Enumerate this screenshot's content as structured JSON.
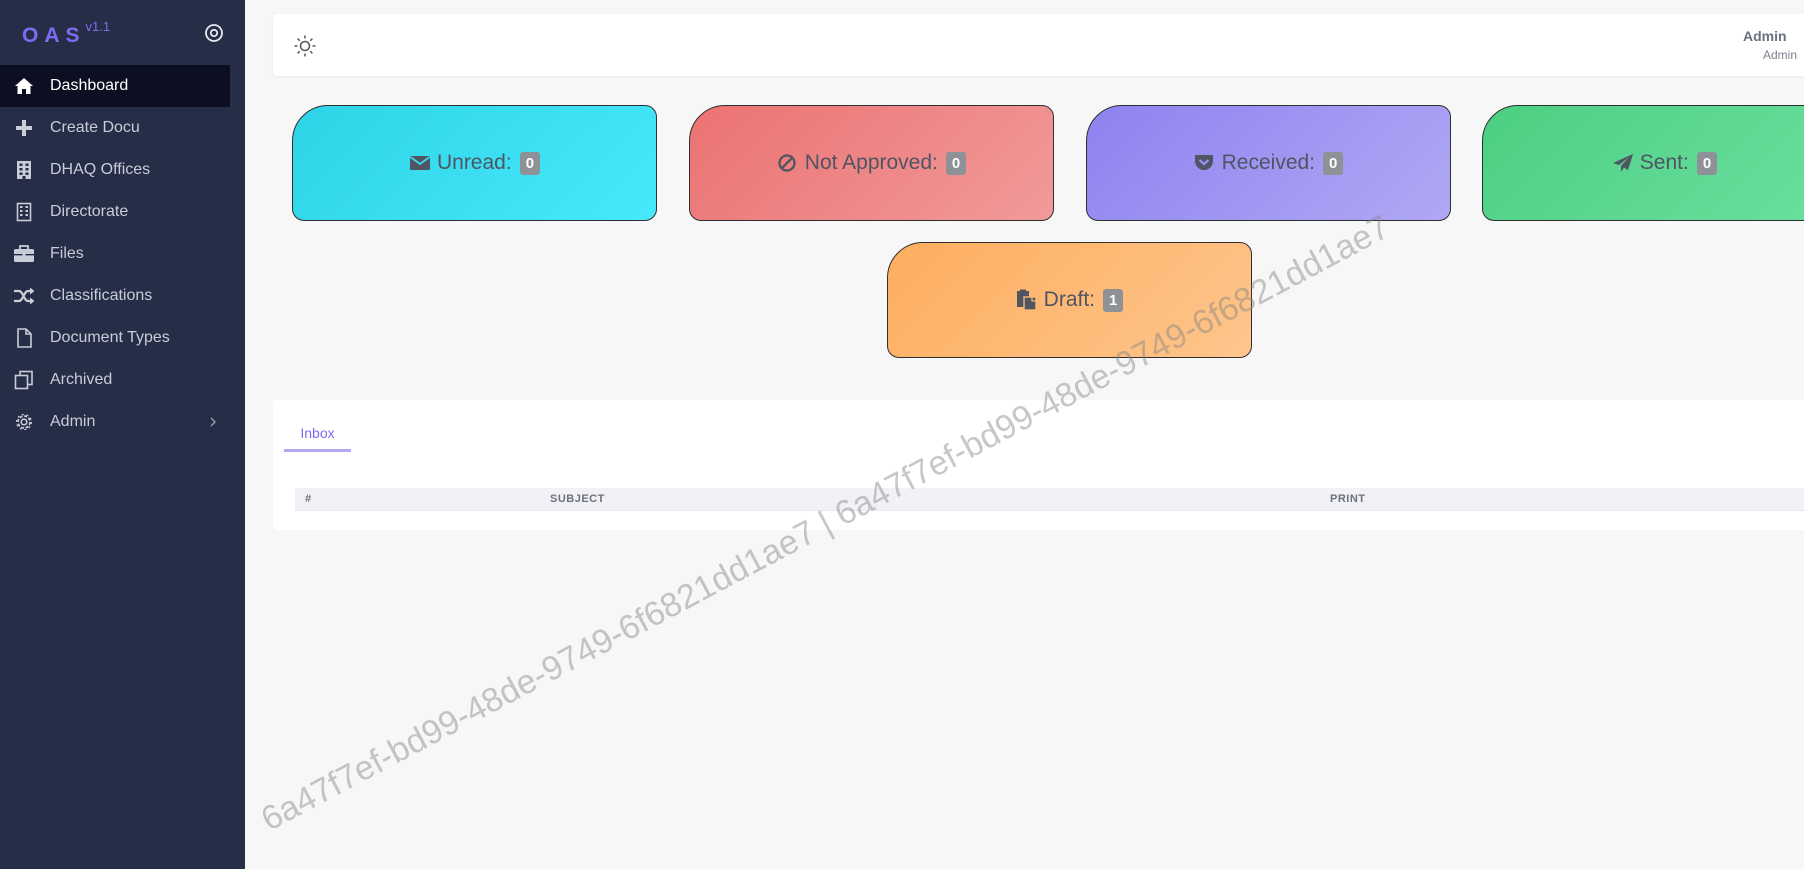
{
  "app": {
    "brand": "OAS",
    "version": "v1.1"
  },
  "sidebar": {
    "items": [
      {
        "label": "Dashboard",
        "icon": "home-icon",
        "active": true
      },
      {
        "label": "Create Docu",
        "icon": "plus-icon"
      },
      {
        "label": "DHAQ Offices",
        "icon": "building-icon"
      },
      {
        "label": "Directorate",
        "icon": "office-icon"
      },
      {
        "label": "Files",
        "icon": "briefcase-icon"
      },
      {
        "label": "Classifications",
        "icon": "shuffle-icon"
      },
      {
        "label": "Document Types",
        "icon": "file-icon"
      },
      {
        "label": "Archived",
        "icon": "copy-icon"
      },
      {
        "label": "Admin",
        "icon": "gear-icon",
        "has_submenu": true
      }
    ]
  },
  "header": {
    "user_name": "Admin",
    "user_role": "Admin",
    "theme_icon": "sun-icon"
  },
  "cards": {
    "unread": {
      "label": "Unread:",
      "count": "0",
      "icon": "envelope-icon",
      "color": "#2ed3e6"
    },
    "not_approved": {
      "label": "Not Approved:",
      "count": "0",
      "icon": "ban-icon",
      "color": "#ec7272"
    },
    "received": {
      "label": "Received:",
      "count": "0",
      "icon": "pocket-icon",
      "color": "#8e82ef"
    },
    "sent": {
      "label": "Sent:",
      "count": "0",
      "icon": "paper-plane-icon",
      "color": "#4ccf82"
    },
    "draft": {
      "label": "Draft:",
      "count": "1",
      "icon": "clipboard-icon",
      "color": "#fdae5f"
    }
  },
  "inbox": {
    "tab_label": "Inbox",
    "columns": [
      "#",
      "SUBJECT",
      "PRINT"
    ],
    "rows": []
  },
  "watermark": "6a47f7ef-bd99-48de-9749-6f6821dd1ae7 | 6a47f7ef-bd99-48de-9749-6f6821dd1ae7",
  "colors": {
    "sidebar_bg": "#252d47",
    "sidebar_active_bg": "#0c0f22",
    "accent": "#7e6cf2"
  }
}
